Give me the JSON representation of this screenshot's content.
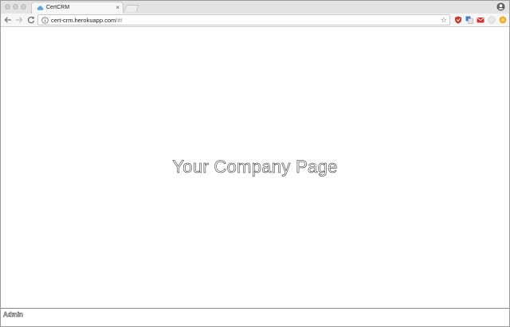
{
  "browser": {
    "tab": {
      "title": "CertCRM",
      "close_glyph": "×",
      "favicon": "cloud-icon"
    },
    "url": {
      "host": "cert-crm.herokuapp.com",
      "path": "/#/"
    },
    "star_glyph": "☆",
    "extensions": [
      "shield-extension-icon",
      "translate-extension-icon",
      "mail-extension-icon",
      "circle-extension-icon",
      "coin-extension-icon"
    ],
    "colors": {
      "shield": "#c0392b",
      "translate": "#4a7bd0",
      "mail": "#cc3333",
      "circle": "#d9d9d9",
      "coin": "#f0a830"
    }
  },
  "page": {
    "heading": "Your Company Page"
  },
  "footer": {
    "user": "Admin"
  }
}
